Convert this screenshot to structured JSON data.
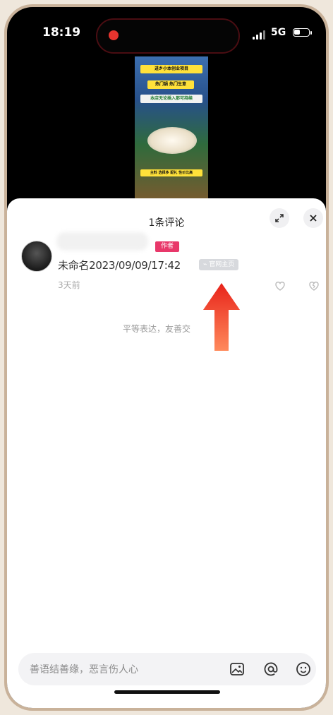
{
  "status_bar": {
    "time": "18:19",
    "network": "5G"
  },
  "video": {
    "banner_top": "进乡小本创业项目",
    "banner_mid": "热门锅 热门生意",
    "banner_sub": "本店无论插入那可持续",
    "banner_bottom": "主料 选择多 配礼 性价比高"
  },
  "comments_sheet": {
    "title": "1条评论",
    "comment": {
      "author_badge": "作者",
      "text": "未命名2023/09/09/17:42",
      "tag": "官网主页",
      "time_ago": "3天前"
    },
    "footer_hint": "平等表达，友善交",
    "input_placeholder": "善语结善缘，恶言伤人心"
  },
  "colors": {
    "author_badge": "#e8386a",
    "arrow": "#f0421c",
    "record_dot": "#e6342e"
  }
}
